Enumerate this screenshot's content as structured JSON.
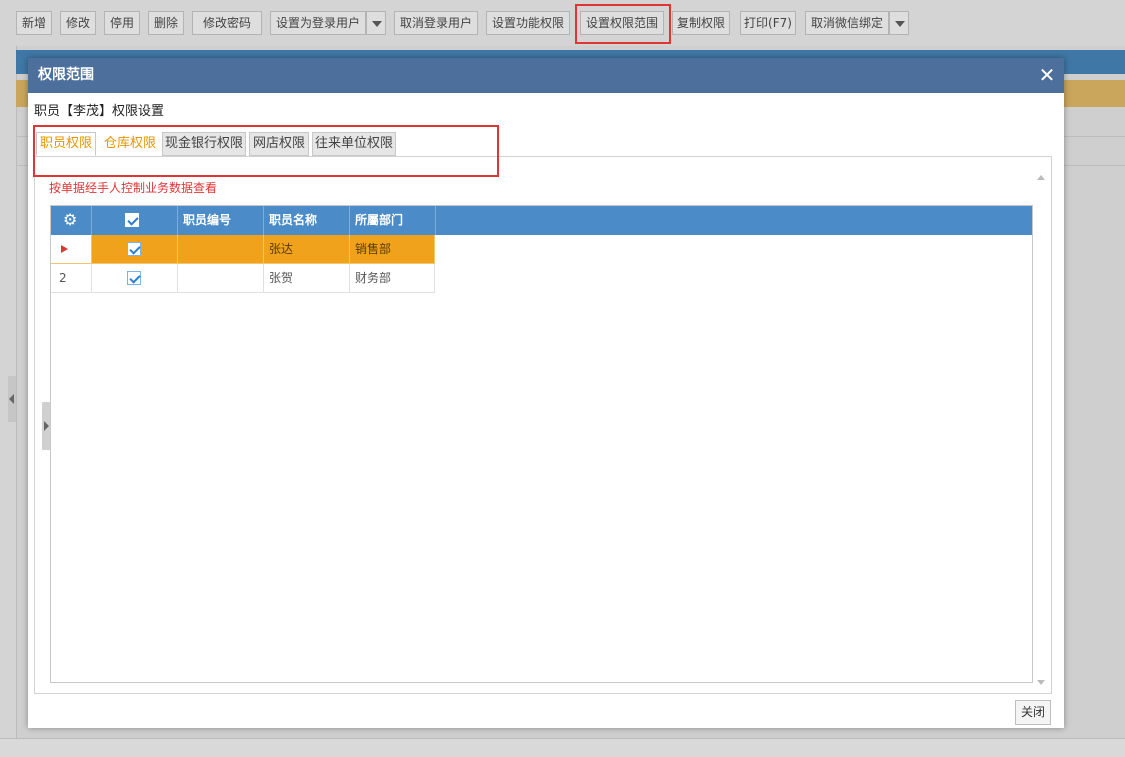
{
  "toolbar": {
    "buttons": [
      "新增",
      "修改",
      "停用",
      "删除",
      "修改密码",
      "设置为登录用户",
      "取消登录用户",
      "设置功能权限",
      "设置权限范围",
      "复制权限",
      "打印(F7)",
      "取消微信绑定"
    ]
  },
  "dialog": {
    "title": "权限范围",
    "subtitle": "职员【李茂】权限设置",
    "tabs": [
      "职员权限",
      "仓库权限",
      "现金银行权限",
      "网店权限",
      "往来单位权限"
    ],
    "active_tab": "职员权限",
    "hint": "按单据经手人控制业务数据查看",
    "grid": {
      "columns": [
        "",
        "",
        "职员编号",
        "职员名称",
        "所屬部门"
      ],
      "rows": [
        {
          "row_marker": "",
          "checked": true,
          "code": "",
          "name": "张达",
          "dept": "销售部",
          "selected": true
        },
        {
          "row_marker": "2",
          "checked": true,
          "code": "",
          "name": "张贺",
          "dept": "财务部",
          "selected": false
        }
      ]
    },
    "close_label": "关闭"
  },
  "colors": {
    "dialog_title_bg": "#4c6f9c",
    "grid_header_bg": "#4a8bc8",
    "selected_row_bg": "#f0a21d",
    "highlight_red": "#e03535",
    "tab_accent": "#e69500"
  }
}
